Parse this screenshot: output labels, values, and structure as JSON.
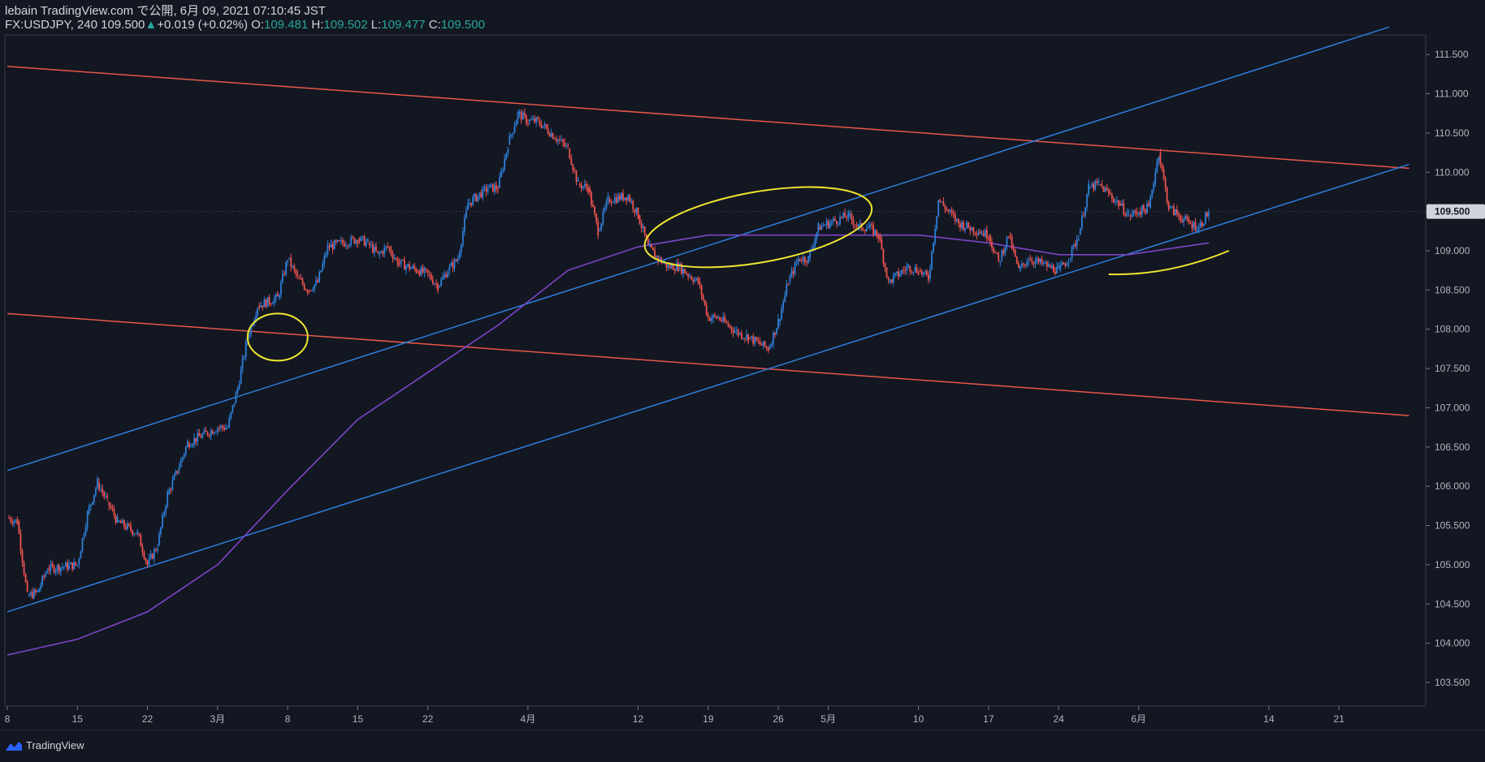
{
  "header": {
    "line1": "lebain TradingView.com で公開, 6月 09, 2021 07:10:45 JST",
    "symbol": "FX:USDJPY, 240",
    "last": "109.500",
    "change_arrow": "▲",
    "change": "+0.019 (+0.02%)",
    "o_label": "O:",
    "o": "109.481",
    "h_label": "H:",
    "h": "109.502",
    "l_label": "L:",
    "l": "109.477",
    "c_label": "C:",
    "c": "109.500"
  },
  "footer": {
    "brand": "TradingView",
    "logo_icon": "tradingview-logo-icon"
  },
  "colors": {
    "background": "#131722",
    "up": "#2e7fd8",
    "down": "#ef5350",
    "trend_red": "#e8574b",
    "trend_blue": "#2b7fdd",
    "ma": "#7e45c8",
    "annotation": "#f0e630",
    "price_tag": "#d1d4dc"
  },
  "chart_data": {
    "type": "candlestick",
    "symbol": "FX:USDJPY",
    "timeframe": "240",
    "ylim": [
      103.2,
      111.75
    ],
    "yticks": [
      "111.500",
      "111.000",
      "110.500",
      "110.000",
      "109.500",
      "109.000",
      "108.500",
      "108.000",
      "107.500",
      "107.000",
      "106.500",
      "106.000",
      "105.500",
      "105.000",
      "104.500",
      "104.000",
      "103.500"
    ],
    "current_price": "109.500",
    "xticks": [
      "8",
      "15",
      "22",
      "3月",
      "8",
      "15",
      "22",
      "4月",
      "12",
      "19",
      "26",
      "5月",
      "10",
      "17",
      "24",
      "6月",
      "14",
      "21"
    ],
    "close_path": [
      {
        "d": "2021-02-08",
        "v": 105.6
      },
      {
        "d": "2021-02-09",
        "v": 105.55
      },
      {
        "d": "2021-02-10",
        "v": 104.6
      },
      {
        "d": "2021-02-11",
        "v": 104.65
      },
      {
        "d": "2021-02-12",
        "v": 104.95
      },
      {
        "d": "2021-02-15",
        "v": 105.0
      },
      {
        "d": "2021-02-16",
        "v": 105.65
      },
      {
        "d": "2021-02-17",
        "v": 106.05
      },
      {
        "d": "2021-02-18",
        "v": 105.8
      },
      {
        "d": "2021-02-19",
        "v": 105.55
      },
      {
        "d": "2021-02-21",
        "v": 105.4
      },
      {
        "d": "2021-02-22",
        "v": 105.0
      },
      {
        "d": "2021-02-23",
        "v": 105.25
      },
      {
        "d": "2021-02-24",
        "v": 105.9
      },
      {
        "d": "2021-02-25",
        "v": 106.2
      },
      {
        "d": "2021-02-26",
        "v": 106.55
      },
      {
        "d": "2021-03-01",
        "v": 106.75
      },
      {
        "d": "2021-03-02",
        "v": 106.75
      },
      {
        "d": "2021-03-03",
        "v": 107.25
      },
      {
        "d": "2021-03-04",
        "v": 107.9
      },
      {
        "d": "2021-03-05",
        "v": 108.3
      },
      {
        "d": "2021-03-07",
        "v": 108.4
      },
      {
        "d": "2021-03-08",
        "v": 108.9
      },
      {
        "d": "2021-03-09",
        "v": 108.65
      },
      {
        "d": "2021-03-10",
        "v": 108.5
      },
      {
        "d": "2021-03-11",
        "v": 108.6
      },
      {
        "d": "2021-03-12",
        "v": 109.05
      },
      {
        "d": "2021-03-15",
        "v": 109.15
      },
      {
        "d": "2021-03-16",
        "v": 109.1
      },
      {
        "d": "2021-03-17",
        "v": 108.95
      },
      {
        "d": "2021-03-18",
        "v": 109.05
      },
      {
        "d": "2021-03-19",
        "v": 108.85
      },
      {
        "d": "2021-03-21",
        "v": 108.75
      },
      {
        "d": "2021-03-22",
        "v": 108.7
      },
      {
        "d": "2021-03-23",
        "v": 108.55
      },
      {
        "d": "2021-03-24",
        "v": 108.75
      },
      {
        "d": "2021-03-25",
        "v": 108.9
      },
      {
        "d": "2021-03-26",
        "v": 109.6
      },
      {
        "d": "2021-03-28",
        "v": 109.8
      },
      {
        "d": "2021-03-29",
        "v": 109.8
      },
      {
        "d": "2021-03-30",
        "v": 110.35
      },
      {
        "d": "2021-03-31",
        "v": 110.75
      },
      {
        "d": "2021-04-01",
        "v": 110.65
      },
      {
        "d": "2021-04-02",
        "v": 110.65
      },
      {
        "d": "2021-04-05",
        "v": 110.3
      },
      {
        "d": "2021-04-06",
        "v": 109.85
      },
      {
        "d": "2021-04-07",
        "v": 109.8
      },
      {
        "d": "2021-04-08",
        "v": 109.25
      },
      {
        "d": "2021-04-09",
        "v": 109.65
      },
      {
        "d": "2021-04-11",
        "v": 109.7
      },
      {
        "d": "2021-04-12",
        "v": 109.45
      },
      {
        "d": "2021-04-13",
        "v": 109.05
      },
      {
        "d": "2021-04-14",
        "v": 108.9
      },
      {
        "d": "2021-04-15",
        "v": 108.8
      },
      {
        "d": "2021-04-16",
        "v": 108.8
      },
      {
        "d": "2021-04-18",
        "v": 108.6
      },
      {
        "d": "2021-04-19",
        "v": 108.15
      },
      {
        "d": "2021-04-20",
        "v": 108.15
      },
      {
        "d": "2021-04-21",
        "v": 108.05
      },
      {
        "d": "2021-04-22",
        "v": 107.95
      },
      {
        "d": "2021-04-23",
        "v": 107.9
      },
      {
        "d": "2021-04-25",
        "v": 107.75
      },
      {
        "d": "2021-04-26",
        "v": 108.1
      },
      {
        "d": "2021-04-27",
        "v": 108.6
      },
      {
        "d": "2021-04-28",
        "v": 108.9
      },
      {
        "d": "2021-04-29",
        "v": 108.9
      },
      {
        "d": "2021-04-30",
        "v": 109.3
      },
      {
        "d": "2021-05-03",
        "v": 109.45
      },
      {
        "d": "2021-05-04",
        "v": 109.3
      },
      {
        "d": "2021-05-05",
        "v": 109.3
      },
      {
        "d": "2021-05-06",
        "v": 109.2
      },
      {
        "d": "2021-05-07",
        "v": 108.6
      },
      {
        "d": "2021-05-09",
        "v": 108.8
      },
      {
        "d": "2021-05-10",
        "v": 108.75
      },
      {
        "d": "2021-05-11",
        "v": 108.65
      },
      {
        "d": "2021-05-12",
        "v": 109.65
      },
      {
        "d": "2021-05-13",
        "v": 109.5
      },
      {
        "d": "2021-05-14",
        "v": 109.35
      },
      {
        "d": "2021-05-16",
        "v": 109.25
      },
      {
        "d": "2021-05-17",
        "v": 109.2
      },
      {
        "d": "2021-05-18",
        "v": 108.85
      },
      {
        "d": "2021-05-19",
        "v": 109.2
      },
      {
        "d": "2021-05-20",
        "v": 108.75
      },
      {
        "d": "2021-05-21",
        "v": 108.9
      },
      {
        "d": "2021-05-23",
        "v": 108.8
      },
      {
        "d": "2021-05-24",
        "v": 108.75
      },
      {
        "d": "2021-05-25",
        "v": 108.9
      },
      {
        "d": "2021-05-26",
        "v": 109.2
      },
      {
        "d": "2021-05-27",
        "v": 109.8
      },
      {
        "d": "2021-05-28",
        "v": 109.85
      },
      {
        "d": "2021-05-30",
        "v": 109.6
      },
      {
        "d": "2021-05-31",
        "v": 109.45
      },
      {
        "d": "2021-06-01",
        "v": 109.5
      },
      {
        "d": "2021-06-02",
        "v": 109.55
      },
      {
        "d": "2021-06-03",
        "v": 110.25
      },
      {
        "d": "2021-06-04",
        "v": 109.55
      },
      {
        "d": "2021-06-06",
        "v": 109.35
      },
      {
        "d": "2021-06-07",
        "v": 109.3
      },
      {
        "d": "2021-06-08",
        "v": 109.5
      }
    ],
    "moving_average": [
      {
        "d": "2021-02-08",
        "v": 103.85
      },
      {
        "d": "2021-02-15",
        "v": 104.05
      },
      {
        "d": "2021-02-22",
        "v": 104.4
      },
      {
        "d": "2021-03-01",
        "v": 105.0
      },
      {
        "d": "2021-03-08",
        "v": 105.95
      },
      {
        "d": "2021-03-15",
        "v": 106.85
      },
      {
        "d": "2021-03-22",
        "v": 107.45
      },
      {
        "d": "2021-03-29",
        "v": 108.05
      },
      {
        "d": "2021-04-05",
        "v": 108.75
      },
      {
        "d": "2021-04-12",
        "v": 109.05
      },
      {
        "d": "2021-04-19",
        "v": 109.2
      },
      {
        "d": "2021-04-26",
        "v": 109.2
      },
      {
        "d": "2021-05-03",
        "v": 109.2
      },
      {
        "d": "2021-05-10",
        "v": 109.2
      },
      {
        "d": "2021-05-17",
        "v": 109.1
      },
      {
        "d": "2021-05-24",
        "v": 108.95
      },
      {
        "d": "2021-05-31",
        "v": 108.95
      },
      {
        "d": "2021-06-08",
        "v": 109.1
      }
    ],
    "trendlines": [
      {
        "name": "red-upper",
        "color": "trend_red",
        "from": {
          "d": "2021-02-08",
          "v": 111.35
        },
        "to": {
          "d": "2021-06-28",
          "v": 110.05
        }
      },
      {
        "name": "red-lower",
        "color": "trend_red",
        "from": {
          "d": "2021-02-08",
          "v": 108.2
        },
        "to": {
          "d": "2021-06-28",
          "v": 106.9
        }
      },
      {
        "name": "blue-upper",
        "color": "trend_blue",
        "from": {
          "d": "2021-02-08",
          "v": 106.2
        },
        "to": {
          "d": "2021-06-26",
          "v": 111.85
        }
      },
      {
        "name": "blue-lower",
        "color": "trend_blue",
        "from": {
          "d": "2021-02-08",
          "v": 104.4
        },
        "to": {
          "d": "2021-06-28",
          "v": 110.1
        }
      }
    ],
    "annotations": [
      {
        "type": "ellipse",
        "center": {
          "d": "2021-03-07",
          "v": 107.9
        },
        "rx_days": 3,
        "ry": 0.3
      },
      {
        "type": "ellipse",
        "center": {
          "d": "2021-04-24",
          "v": 109.3
        },
        "rx_days": 11.5,
        "ry": 0.45,
        "tilt": -10
      },
      {
        "type": "underline",
        "from": {
          "d": "2021-05-29",
          "v": 108.7
        },
        "to": {
          "d": "2021-06-10",
          "v": 109.0
        }
      }
    ],
    "grid": false,
    "legend": "none"
  }
}
